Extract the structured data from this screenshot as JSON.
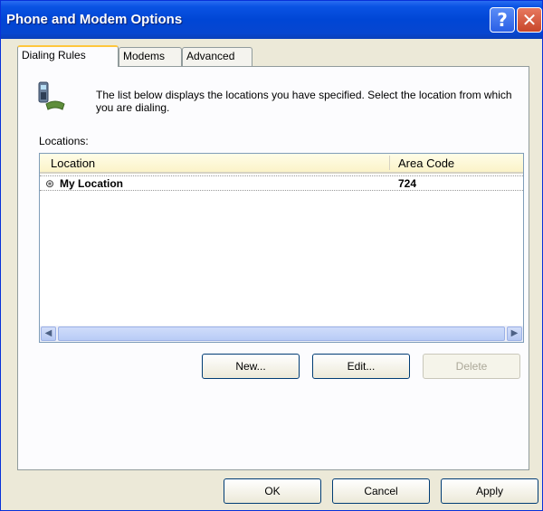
{
  "window": {
    "title": "Phone and Modem Options"
  },
  "titlebar": {
    "help_glyph": "?",
    "close_glyph": "✕"
  },
  "tabs": [
    {
      "label": "Dialing Rules",
      "active": true
    },
    {
      "label": "Modems",
      "active": false
    },
    {
      "label": "Advanced",
      "active": false
    }
  ],
  "dialing_rules": {
    "description": "The list below displays the locations you have specified. Select the location from which you are dialing.",
    "locations_label": "Locations:",
    "columns": [
      "Location",
      "Area Code"
    ],
    "rows": [
      {
        "location": "My Location",
        "area_code": "724"
      }
    ],
    "buttons": {
      "new": "New...",
      "edit": "Edit...",
      "delete": "Delete"
    }
  },
  "footer": {
    "ok": "OK",
    "cancel": "Cancel",
    "apply": "Apply"
  },
  "colors": {
    "titlebar": "#0046d5",
    "panel": "#fcfcfe",
    "dialog": "#ece9d8",
    "active_tab_accent": "#ffc73c"
  },
  "icons": {
    "info": "phone-location-icon",
    "row": "location-pin-icon"
  }
}
